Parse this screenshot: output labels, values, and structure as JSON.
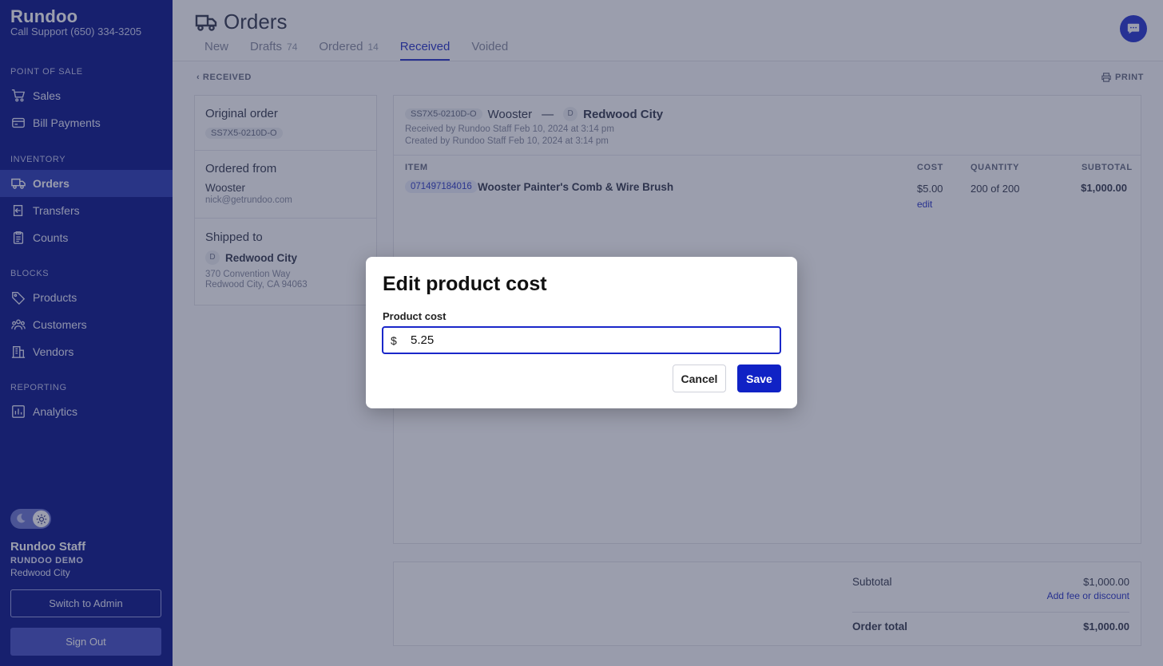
{
  "sidebar": {
    "brand": "Rundoo",
    "support": "Call Support (650) 334-3205",
    "sections": {
      "pos": "POINT OF SALE",
      "inventory": "INVENTORY",
      "blocks": "BLOCKS",
      "reporting": "REPORTING"
    },
    "items": {
      "sales": "Sales",
      "bill_payments": "Bill Payments",
      "orders": "Orders",
      "transfers": "Transfers",
      "counts": "Counts",
      "products": "Products",
      "customers": "Customers",
      "vendors": "Vendors",
      "analytics": "Analytics"
    },
    "user": {
      "name": "Rundoo Staff",
      "org": "RUNDOO DEMO",
      "location": "Redwood City"
    },
    "switch_admin_label": "Switch to Admin",
    "sign_out_label": "Sign Out",
    "theme_toggle": "light"
  },
  "header": {
    "title": "Orders",
    "tabs": [
      {
        "label": "New",
        "count": ""
      },
      {
        "label": "Drafts",
        "count": "74"
      },
      {
        "label": "Ordered",
        "count": "14"
      },
      {
        "label": "Received",
        "count": ""
      },
      {
        "label": "Voided",
        "count": ""
      }
    ],
    "active_tab": "Received"
  },
  "toolbar": {
    "back_label": "RECEIVED",
    "print_label": "PRINT"
  },
  "summary": {
    "original_order": {
      "heading": "Original order",
      "order_id": "SS7X5-0210D-O"
    },
    "ordered_from": {
      "heading": "Ordered from",
      "vendor": "Wooster",
      "email": "nick@getrundoo.com"
    },
    "shipped_to": {
      "heading": "Shipped to",
      "badge": "D",
      "store": "Redwood City",
      "address_line1": "370 Convention Way",
      "address_line2": "Redwood City, CA 94063"
    }
  },
  "order": {
    "order_id": "SS7X5-0210D-O",
    "vendor": "Wooster",
    "dash": "—",
    "dest_badge": "D",
    "destination": "Redwood City",
    "received_line": "Received by Rundoo Staff Feb 10, 2024 at 3:14 pm",
    "created_line": "Created by Rundoo Staff Feb 10, 2024 at 3:14 pm",
    "columns": {
      "item": "ITEM",
      "cost": "COST",
      "quantity": "QUANTITY",
      "subtotal": "SUBTOTAL"
    },
    "lines": [
      {
        "sku": "071497184016",
        "name": "Wooster Painter's Comb & Wire Brush",
        "cost": "$5.00",
        "edit_label": "edit",
        "quantity": "200 of 200",
        "subtotal": "$1,000.00"
      }
    ]
  },
  "totals": {
    "subtotal_label": "Subtotal",
    "subtotal_value": "$1,000.00",
    "add_fee_label": "Add fee or discount",
    "order_total_label": "Order total",
    "order_total_value": "$1,000.00"
  },
  "modal": {
    "title": "Edit product cost",
    "field_label": "Product cost",
    "currency_prefix": "$",
    "value": "5.25",
    "cancel_label": "Cancel",
    "save_label": "Save"
  },
  "colors": {
    "sidebar_bg": "#0f1a8c",
    "accent": "#1022c5",
    "link": "#2d39c9"
  }
}
